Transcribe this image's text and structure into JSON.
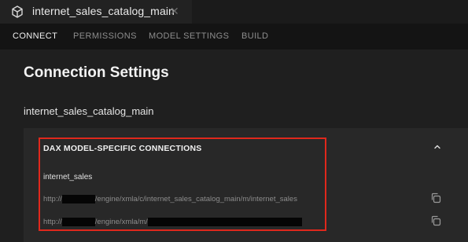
{
  "file_tab": {
    "title": "internet_sales_catalog_main",
    "icon": "cube-icon",
    "close_glyph": "✕"
  },
  "nav": {
    "items": [
      {
        "label": "CONNECT",
        "active": true
      },
      {
        "label": "PERMISSIONS",
        "active": false
      },
      {
        "label": "MODEL SETTINGS",
        "active": false
      },
      {
        "label": "BUILD",
        "active": false
      }
    ]
  },
  "main": {
    "title": "Connection Settings",
    "model_name": "internet_sales_catalog_main"
  },
  "panel": {
    "header": "DAX MODEL-SPECIFIC CONNECTIONS",
    "collapse_icon": "chevron-up-icon",
    "sub_label": "internet_sales",
    "connections": [
      {
        "prefix": "http://",
        "suffix": "/engine/xmla/c/internet_sales_catalog_main/m/internet_sales",
        "redacted": true
      },
      {
        "prefix": "http://",
        "suffix": "/engine/xmla/m/",
        "redacted": true
      }
    ],
    "copy_icon": "copy-icon"
  },
  "colors": {
    "highlight": "#e0281c",
    "background": "#1f1f1f",
    "panel": "#282828"
  }
}
